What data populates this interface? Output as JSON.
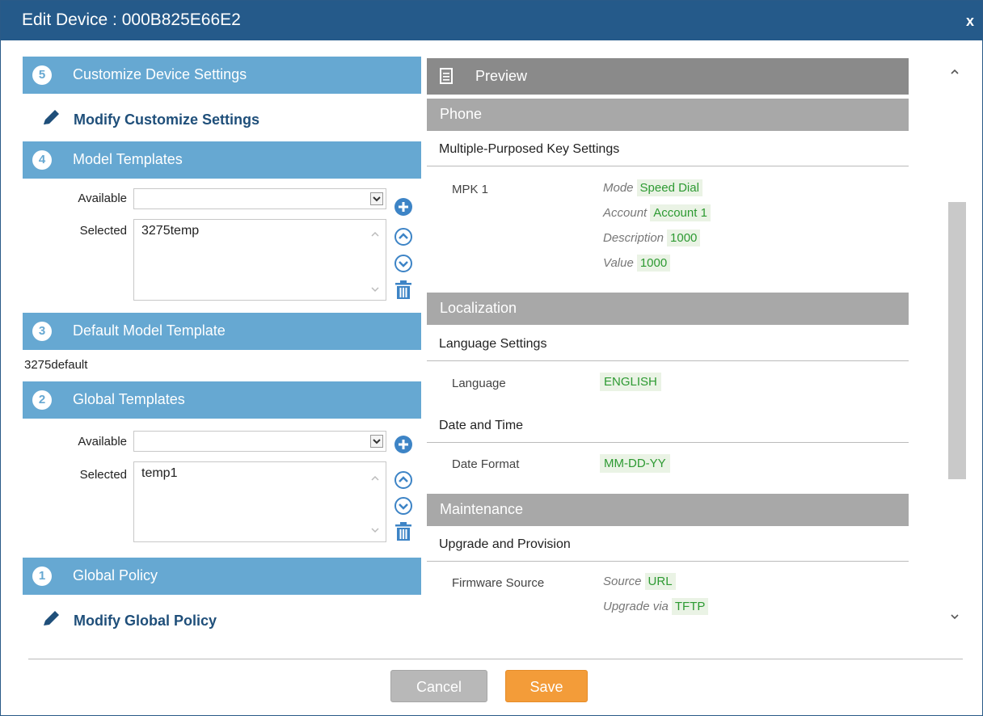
{
  "dialog": {
    "title": "Edit Device : 000B825E66E2",
    "close_label": "x"
  },
  "left": {
    "sections": [
      {
        "number": "5",
        "label": "Customize Device Settings"
      },
      {
        "number": "4",
        "label": "Model Templates"
      },
      {
        "number": "3",
        "label": "Default Model Template"
      },
      {
        "number": "2",
        "label": "Global Templates"
      },
      {
        "number": "1",
        "label": "Global Policy"
      }
    ],
    "modify_customize_label": "Modify Customize Settings",
    "modify_policy_label": "Modify Global Policy",
    "model_templates": {
      "available_label": "Available",
      "available_value": "",
      "selected_label": "Selected",
      "selected_items": [
        "3275temp"
      ]
    },
    "default_model_template": "3275default",
    "global_templates": {
      "available_label": "Available",
      "available_value": "",
      "selected_label": "Selected",
      "selected_items": [
        "temp1"
      ]
    }
  },
  "preview": {
    "title": "Preview",
    "phone": {
      "category": "Phone",
      "subsection": "Multiple-Purposed Key Settings",
      "row_label": "MPK 1",
      "fields": [
        {
          "key": "Mode",
          "value": "Speed Dial"
        },
        {
          "key": "Account",
          "value": "Account 1"
        },
        {
          "key": "Description",
          "value": "1000"
        },
        {
          "key": "Value",
          "value": "1000"
        }
      ]
    },
    "localization": {
      "category": "Localization",
      "language_subsection": "Language Settings",
      "language_label": "Language",
      "language_value": "ENGLISH",
      "datetime_subsection": "Date and Time",
      "date_format_label": "Date Format",
      "date_format_value": "MM-DD-YY"
    },
    "maintenance": {
      "category": "Maintenance",
      "subsection": "Upgrade and Provision",
      "row_label": "Firmware Source",
      "fields": [
        {
          "key": "Source",
          "value": "URL"
        },
        {
          "key": "Upgrade via",
          "value": "TFTP"
        }
      ]
    }
  },
  "footer": {
    "cancel_label": "Cancel",
    "save_label": "Save"
  },
  "colors": {
    "title_bar": "#255a8a",
    "section_header": "#66a8d2",
    "preview_header": "#8a8a8a",
    "category_header": "#a8a8a8",
    "value_green": "#2d9a32",
    "save_button": "#f39c39",
    "cancel_button": "#b8b8b8"
  }
}
